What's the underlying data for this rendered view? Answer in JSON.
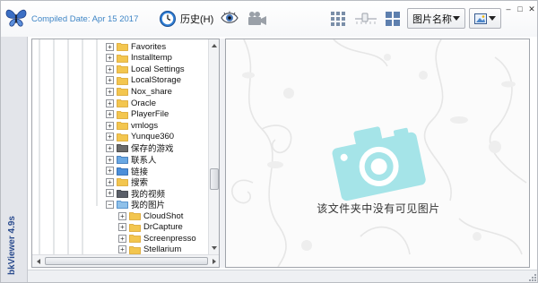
{
  "app": {
    "compiled_text": "Compiled Date: Apr 15 2017",
    "version_text": "bkViewer 4.9s",
    "logo_icon": "butterfly-icon",
    "accent_color": "#3f86c6"
  },
  "toolbar": {
    "history_label": "历史(H)",
    "history_icon": "clock-icon",
    "eye_icon": "eye-icon",
    "camera_icon": "camera-icon",
    "grid_large_icon": "grid-large-icon",
    "grid_small_icon": "grid-small-icon",
    "sort_dropdown_value": "图片名称",
    "view_dropdown_icon": "image-view-icon"
  },
  "window_controls": {
    "minimize": "–",
    "maximize": "□",
    "close": "✕"
  },
  "tree": {
    "items": [
      {
        "label": "Favorites",
        "level": 0,
        "expanded": false,
        "icon": "folder-icon"
      },
      {
        "label": "Installtemp",
        "level": 0,
        "expanded": false,
        "icon": "folder-icon"
      },
      {
        "label": "Local Settings",
        "level": 0,
        "expanded": false,
        "icon": "folder-icon"
      },
      {
        "label": "LocalStorage",
        "level": 0,
        "expanded": false,
        "icon": "folder-icon"
      },
      {
        "label": "Nox_share",
        "level": 0,
        "expanded": false,
        "icon": "folder-icon"
      },
      {
        "label": "Oracle",
        "level": 0,
        "expanded": false,
        "icon": "folder-icon"
      },
      {
        "label": "PlayerFile",
        "level": 0,
        "expanded": false,
        "icon": "folder-icon"
      },
      {
        "label": "vmlogs",
        "level": 0,
        "expanded": false,
        "icon": "folder-icon"
      },
      {
        "label": "Yunque360",
        "level": 0,
        "expanded": false,
        "icon": "folder-icon"
      },
      {
        "label": "保存的游戏",
        "level": 0,
        "expanded": false,
        "icon": "saved-games-icon"
      },
      {
        "label": "联系人",
        "level": 0,
        "expanded": false,
        "icon": "contacts-icon"
      },
      {
        "label": "链接",
        "level": 0,
        "expanded": false,
        "icon": "links-icon"
      },
      {
        "label": "搜索",
        "level": 0,
        "expanded": false,
        "icon": "search-folder-icon"
      },
      {
        "label": "我的视频",
        "level": 0,
        "expanded": false,
        "icon": "videos-icon"
      },
      {
        "label": "我的图片",
        "level": 0,
        "expanded": true,
        "icon": "pictures-icon"
      },
      {
        "label": "CloudShot",
        "level": 1,
        "expanded": false,
        "icon": "folder-icon"
      },
      {
        "label": "DrCapture",
        "level": 1,
        "expanded": false,
        "icon": "folder-icon"
      },
      {
        "label": "Screenpresso",
        "level": 1,
        "expanded": false,
        "icon": "folder-icon"
      },
      {
        "label": "Stellarium",
        "level": 1,
        "expanded": false,
        "icon": "folder-icon"
      }
    ]
  },
  "image_panel": {
    "empty_message": "该文件夹中没有可见图片",
    "placeholder_icon": "camera-placeholder-icon",
    "placeholder_color": "#8fdbe0"
  }
}
